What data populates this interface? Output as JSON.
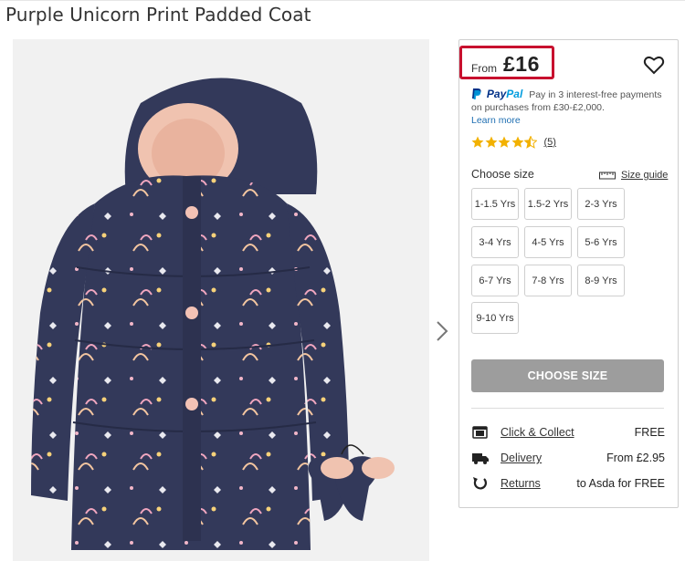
{
  "product": {
    "title": "Purple Unicorn Print Padded Coat"
  },
  "price": {
    "from_label": "From",
    "value": "£16"
  },
  "paypal": {
    "brand_a": "Pay",
    "brand_b": "Pal",
    "text": "Pay in 3 interest-free payments on purchases from £30-£2,000.",
    "learn_more": "Learn more"
  },
  "rating": {
    "stars": 4.5,
    "review_count": "(5)"
  },
  "size_selector": {
    "label": "Choose size",
    "guide_label": "Size guide",
    "options": [
      "1-1.5 Yrs",
      "1.5-2 Yrs",
      "2-3 Yrs",
      "3-4 Yrs",
      "4-5 Yrs",
      "5-6 Yrs",
      "6-7 Yrs",
      "7-8 Yrs",
      "8-9 Yrs",
      "9-10 Yrs"
    ]
  },
  "cta": {
    "label": "CHOOSE SIZE"
  },
  "delivery": [
    {
      "icon": "store-icon",
      "label": "Click & Collect",
      "value": "FREE"
    },
    {
      "icon": "truck-icon",
      "label": "Delivery",
      "value": "From £2.95"
    },
    {
      "icon": "returns-icon",
      "label": "Returns",
      "value": "to Asda for FREE"
    }
  ],
  "colors": {
    "accent_red": "#c8102e",
    "star": "#f2b100",
    "coat_navy": "#33395a",
    "cta_grey": "#9d9d9d",
    "paypal_dark": "#003087",
    "paypal_light": "#009cde"
  }
}
